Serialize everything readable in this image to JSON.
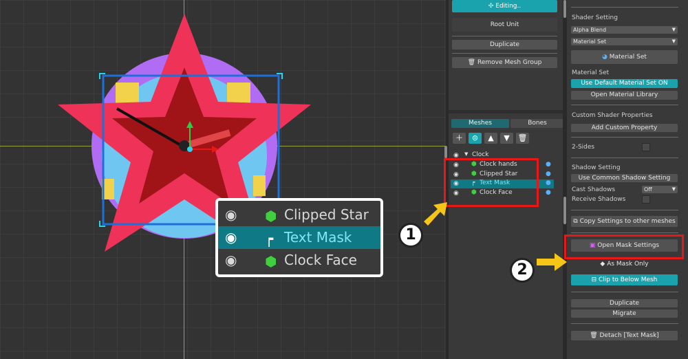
{
  "viewport": {
    "zoom_rows": [
      {
        "label": "Clipped Star",
        "icon": "mesh-icon",
        "selected": false
      },
      {
        "label": "Text Mask",
        "icon": "mask-child-icon",
        "selected": true
      },
      {
        "label": "Clock Face",
        "icon": "mesh-icon",
        "selected": false
      }
    ]
  },
  "mid_panel": {
    "editing_label": "Editing..",
    "root_unit_label": "Root Unit",
    "duplicate_label": "Duplicate",
    "remove_mesh_group_label": "Remove Mesh Group",
    "tabs": [
      {
        "label": "Meshes",
        "active": true
      },
      {
        "label": "Bones",
        "active": false
      }
    ],
    "tree": {
      "root": "Clock",
      "items": [
        {
          "label": "Clock hands",
          "icon": "mesh-icon",
          "selected": false
        },
        {
          "label": "Clipped Star",
          "icon": "mesh-icon",
          "selected": false
        },
        {
          "label": "Text Mask",
          "icon": "mask-child-icon",
          "selected": true
        },
        {
          "label": "Clock Face",
          "icon": "mesh-icon",
          "selected": false
        }
      ]
    }
  },
  "right_panel": {
    "shader_setting_label": "Shader Setting",
    "blend_mode_value": "Alpha Blend",
    "material_set_dropdown_value": "Material Set",
    "material_set_button": "Material Set",
    "material_set_heading": "Material Set",
    "use_default_material_button": "Use Default Material Set ON",
    "open_material_library_button": "Open Material Library",
    "custom_shader_label": "Custom Shader Properties",
    "add_custom_property_button": "Add Custom Property",
    "two_sides_label": "2-Sides",
    "shadow_setting_label": "Shadow Setting",
    "use_common_shadow_button": "Use Common Shadow Setting",
    "cast_shadows_label": "Cast Shadows",
    "cast_shadows_value": "Off",
    "receive_shadows_label": "Receive Shadows",
    "copy_settings_button": "Copy Settings to other meshes",
    "open_mask_settings_button": "Open Mask Settings",
    "as_mask_only_button": "As Mask Only",
    "clip_below_button": "Clip to Below Mesh",
    "duplicate_button": "Duplicate",
    "migrate_button": "Migrate",
    "detach_button": "Detach [Text Mask]"
  },
  "annotations": {
    "marker_1": "1",
    "marker_2": "2"
  },
  "colors": {
    "accent_teal": "#1aa3ad",
    "selection": "#0f7a86",
    "highlight_red": "#e81818",
    "arrow_yellow": "#f5c518",
    "star_red": "#ef3358",
    "star_dark": "#a01418"
  }
}
